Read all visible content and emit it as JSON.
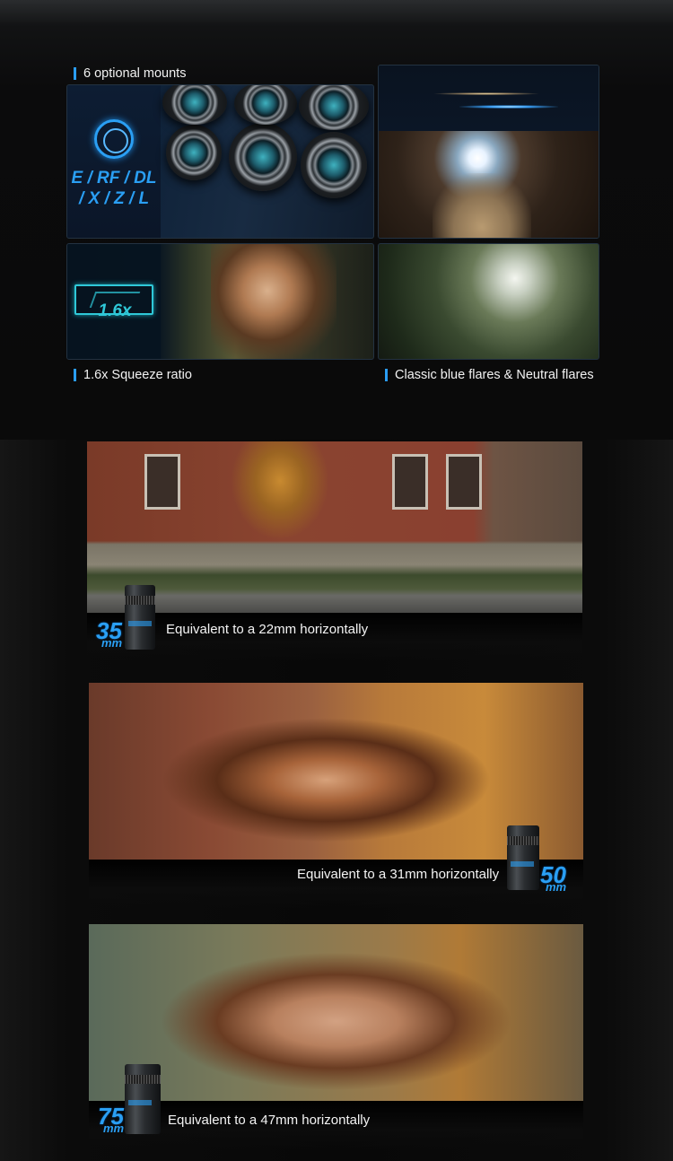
{
  "features": {
    "mounts": {
      "caption": "6 optional mounts",
      "mounts_line1": "E / RF / DL",
      "mounts_line2": "/ X / Z / L",
      "icon": "rotating-ring-icon"
    },
    "squeeze": {
      "caption": "1.6x Squeeze ratio",
      "badge": "1.6x",
      "icon": "widescreen-frame-icon"
    },
    "flares": {
      "caption": "Classic blue flares & Neutral flares"
    }
  },
  "lenses": [
    {
      "focal_number": "35",
      "focal_unit": "mm",
      "equivalent": "Equivalent to a 22mm horizontally"
    },
    {
      "focal_number": "50",
      "focal_unit": "mm",
      "equivalent": "Equivalent to a 31mm horizontally"
    },
    {
      "focal_number": "75",
      "focal_unit": "mm",
      "equivalent": "Equivalent to a 47mm horizontally"
    }
  ],
  "colors": {
    "accent_blue": "#2a9df4",
    "squeeze_cyan": "#2fc8d8",
    "background": "#0a0a0a"
  }
}
